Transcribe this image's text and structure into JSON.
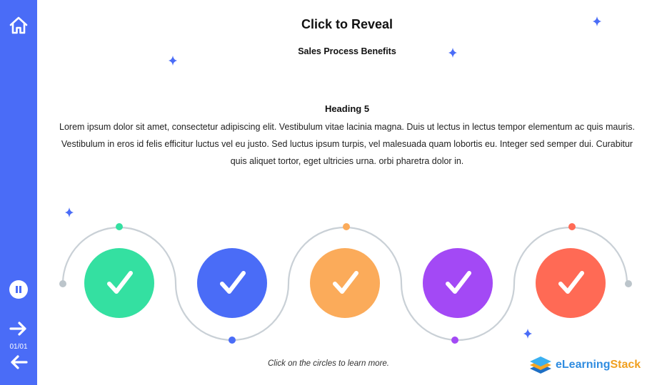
{
  "header": {
    "title": "Click to Reveal",
    "subtitle": "Sales Process Benefits"
  },
  "content": {
    "heading": "Heading 5",
    "body": "Lorem ipsum dolor sit amet, consectetur adipiscing elit. Vestibulum vitae lacinia magna. Duis ut lectus in lectus tempor elementum ac quis mauris. Vestibulum in eros id felis efficitur luctus vel eu justo. Sed luctus ipsum turpis, vel malesuada quam lobortis eu. Integer sed semper dui. Curabitur quis aliquet tortor, eget ultricies urna. orbi pharetra dolor in."
  },
  "sidebar": {
    "home_icon": "home-icon",
    "pause_icon": "pause-icon",
    "next_icon": "arrow-right-icon",
    "prev_icon": "arrow-left-icon",
    "page_count": "01/01"
  },
  "steps": [
    {
      "color": "#34e0a1",
      "icon": "checkmark-icon"
    },
    {
      "color": "#4a6cf7",
      "icon": "checkmark-icon"
    },
    {
      "color": "#fbab5a",
      "icon": "checkmark-icon"
    },
    {
      "color": "#a349f5",
      "icon": "checkmark-icon"
    },
    {
      "color": "#ff6a55",
      "icon": "checkmark-icon"
    }
  ],
  "footer": {
    "instruction": "Click on the circles to learn more."
  },
  "logo": {
    "part1": "eLearning",
    "part2": "Stack"
  },
  "colors": {
    "sidebar": "#4a6cf7",
    "path": "#c9d0d6",
    "sparkle": "#4a6cf7"
  }
}
